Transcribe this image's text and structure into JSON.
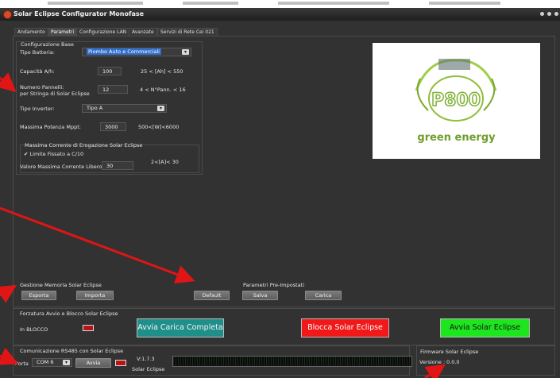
{
  "window": {
    "title": "Solar Eclipse Configurator Monofase"
  },
  "tabs": [
    {
      "label": "Andamento",
      "active": false
    },
    {
      "label": "Parametri",
      "active": true
    },
    {
      "label": "Configurazione LAN",
      "active": false
    },
    {
      "label": "Avanzate",
      "active": false
    },
    {
      "label": "Servizi di Rete Cei 021",
      "active": false
    }
  ],
  "config": {
    "section_title": "Configurazione Base",
    "battery_type_label": "Tipo Batteria:",
    "battery_type_value": "Piombo Auto e Commerciali",
    "capacity_label": "Capacità A/h:",
    "capacity_value": "100",
    "capacity_range": "25 < [Ah] < 550",
    "panels_label_1": "Numero Pannelli:",
    "panels_label_2": "per Stringa di  Solar Eclipse",
    "panels_value": "12",
    "panels_range": "4 < N°Pann. < 16",
    "inverter_label": "Tipo Inverter:",
    "inverter_value": "Tipo A",
    "mppt_label": "Massima Potenza Mppt:",
    "mppt_value": "3000",
    "mppt_range": "500<[W]<6000",
    "current_section": "Massima Corrente di Erogazione Solar Eclipse",
    "current_check_label": "Limite Fissato a C/10",
    "current_check_checked": true,
    "current_free_label": "Valore Massima Corrente Libero:",
    "current_free_value": "30",
    "current_range": "2<[A]< 30"
  },
  "logo": {
    "text": "green energy"
  },
  "memory": {
    "section_title": "Gestione Memoria  Solar Eclipse",
    "export_label": "Esporta",
    "import_label": "Importa",
    "default_label": "Default"
  },
  "presets": {
    "section_title": "Parametri Pre-Impostati",
    "save_label": "Salva",
    "load_label": "Carica"
  },
  "forcing": {
    "section_title": "Forzatura Avvio e Blocco Solar Eclipse",
    "status_text": "In BLOCCO",
    "status_color": "#b31616",
    "full_charge_label": "Avvia Carica Completa",
    "full_charge_color": "#1f8f8a",
    "block_label": "Blocca Solar Eclipse",
    "block_color": "#f01818",
    "start_label": "Avvia Solar Eclipse",
    "start_color": "#1ee61e"
  },
  "comm": {
    "section_title": "Comunicazione RS485 con  Solar Eclipse",
    "port_label": "Porta",
    "port_value": "COM 6",
    "start_label": "Avvia",
    "version_text": "V:1.7.3",
    "device_text": "Solar Eclipse"
  },
  "firmware": {
    "section_title": "Firmware  Solar Eclipse",
    "version_label": "Versione :",
    "version_value": "0.0.0"
  }
}
